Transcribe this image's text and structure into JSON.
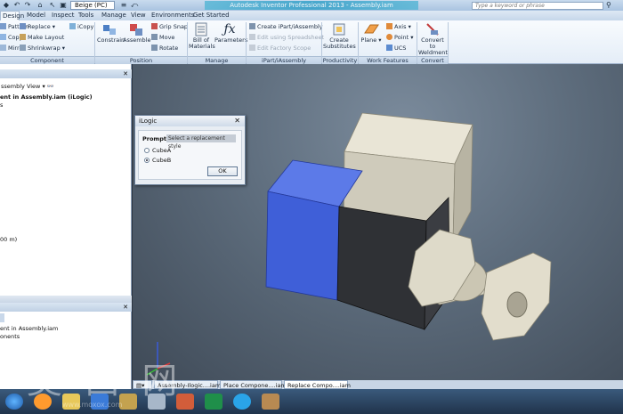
{
  "titlebar": {
    "style_combo": "Beige (PC)",
    "title": "Autodesk Inventor Professional 2013 - Assembly.iam",
    "search_placeholder": "Type a keyword or phrase"
  },
  "tabs": [
    "Design",
    "Model",
    "Inspect",
    "Tools",
    "Manage",
    "View",
    "Environments",
    "Get Started"
  ],
  "ribbon": {
    "component": {
      "label": "Component",
      "items": [
        "Pattern",
        "Copy",
        "Mirror",
        "Replace",
        "Make Layout",
        "Shrinkwrap",
        "iCopy"
      ]
    },
    "position": {
      "label": "Position",
      "constrain": "Constrain",
      "assemble": "Assemble",
      "grip_snap": "Grip Snap",
      "move": "Move",
      "rotate": "Rotate"
    },
    "manage": {
      "label": "Manage",
      "bill_of_materials": "Bill of Materials",
      "parameters": "Parameters"
    },
    "ipart": {
      "label": "iPart/iAssembly",
      "create": "Create iPart/iAssembly",
      "edit": "Edit using Spreadsheet",
      "scope": "Edit Factory Scope"
    },
    "productivity": {
      "label": "Productivity",
      "create_substitutes": "Create Substitutes"
    },
    "work_features": {
      "label": "Work Features",
      "plane": "Plane",
      "axis": "Axis",
      "point": "Point",
      "ucs": "UCS"
    },
    "convert": {
      "label": "Convert",
      "to_weldment": "Convert to Weldment"
    }
  },
  "browser": {
    "view": "ssembly View",
    "root": "ent in Assembly.iam (iLogic)",
    "row_s": "s",
    "row_m": "00 m)"
  },
  "panel2": {
    "row1": "ent in Assembly.iam",
    "row2": "onents"
  },
  "dialog": {
    "title": "iLogic",
    "prompt_label": "Prompt",
    "prompt_value": "Select a replacement style",
    "options": [
      "CubeA",
      "CubeB"
    ],
    "selected": "CubeB",
    "ok": "OK"
  },
  "doc_tabs": [
    "Assembly-Ilogic....iam",
    "Place Compone....iam",
    "Replace Compo....iam"
  ],
  "watermark": {
    "text": "莫 西 网",
    "url": "www.moxox.com"
  },
  "colors": {
    "cube_a": "#3f5fd8",
    "cube_b": "#2f3135",
    "housing": "#d8d4c4"
  }
}
